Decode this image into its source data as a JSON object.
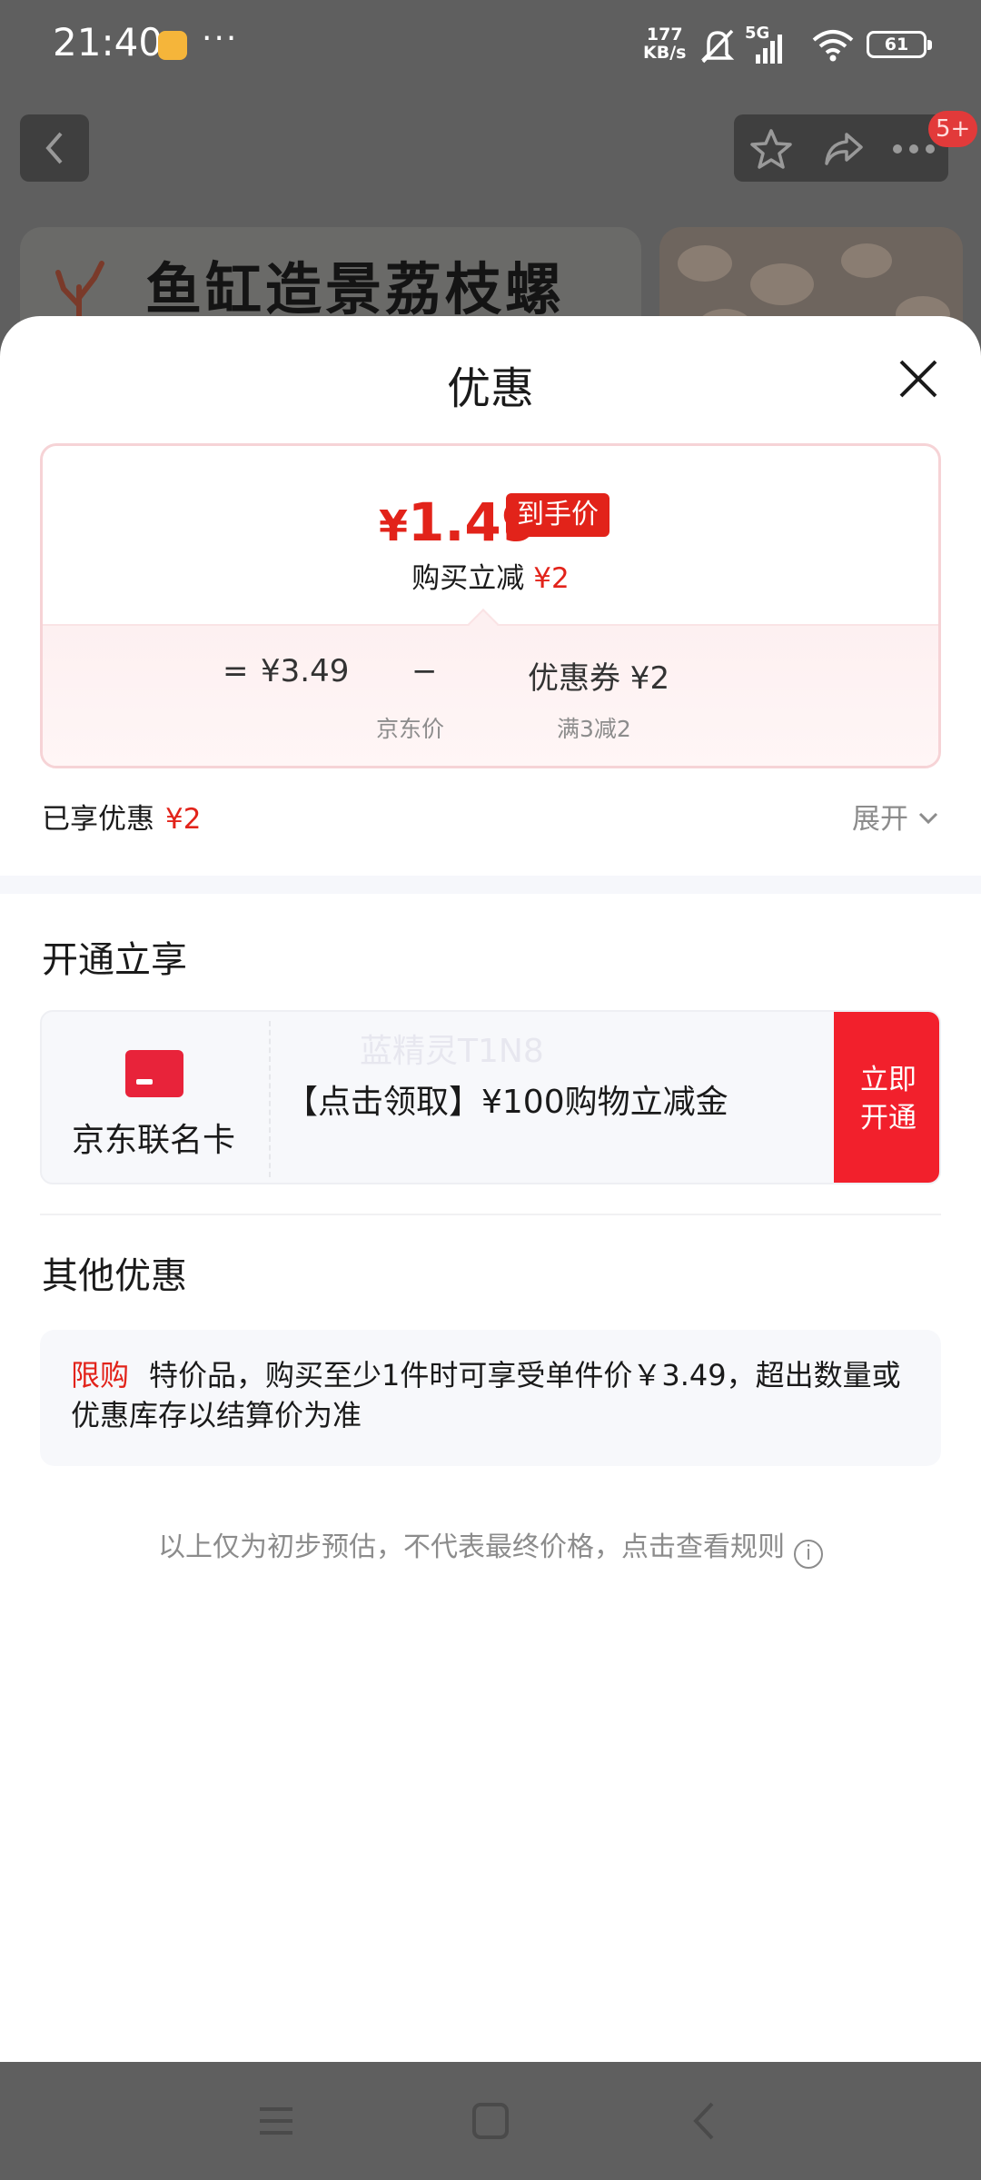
{
  "status_bar": {
    "time": "21:40",
    "more": "···",
    "net_speed_value": "177",
    "net_speed_unit": "KB/s",
    "network": "5G",
    "battery": "61"
  },
  "background_page": {
    "banner_title": "鱼缸造景荔枝螺",
    "badge": "5+"
  },
  "sheet": {
    "title": "优惠",
    "price_card": {
      "final_price_symbol": "¥",
      "final_price": "1.49",
      "final_price_tag": "到手价",
      "instant_cut_label": "购买立减",
      "instant_cut_amount": "¥2",
      "formula": {
        "equals": "=",
        "jd_price": "¥3.49",
        "minus": "−",
        "coupon": "优惠券 ¥2",
        "jd_price_label": "京东价",
        "coupon_condition": "满3减2"
      }
    },
    "enjoyed": {
      "label": "已享优惠",
      "amount": "¥2",
      "expand": "展开"
    },
    "open_section": {
      "title": "开通立享",
      "card_name": "京东联名卡",
      "watermark": "蓝精灵T1N8",
      "benefit": "【点击领取】¥100购物立减金",
      "button_line1": "立即",
      "button_line2": "开通"
    },
    "other_section": {
      "title": "其他优惠",
      "limit_tag": "限购",
      "limit_text": "特价品，购买至少1件时可享受单件价￥3.49，超出数量或优惠库存以结算价为准"
    },
    "disclaimer": "以上仅为初步预估，不代表最终价格，点击查看规则",
    "info_glyph": "i"
  },
  "colors": {
    "accent_red": "#e2231a",
    "button_red": "#f2202c"
  },
  "icons": [
    "back-icon",
    "star-icon",
    "share-icon",
    "more-icon",
    "close-icon",
    "chevron-down-icon",
    "card-icon",
    "info-icon",
    "menu-icon",
    "home-icon",
    "nav-back-icon"
  ]
}
